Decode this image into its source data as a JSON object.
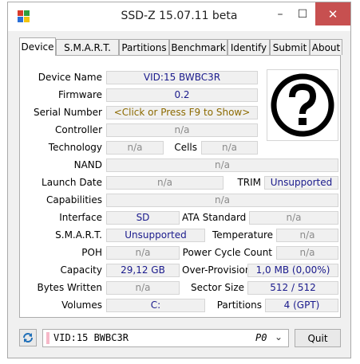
{
  "window": {
    "title": "SSD-Z 15.07.11 beta",
    "controls": {
      "minimize": "–",
      "maximize": "☐",
      "close": "✕"
    }
  },
  "tabs": [
    "Device",
    "S.M.A.R.T.",
    "Partitions",
    "Benchmark",
    "Identify",
    "Submit",
    "About"
  ],
  "active_tab": "Device",
  "device": {
    "device_name_label": "Device Name",
    "device_name": "VID:15 BWBC3R",
    "firmware_label": "Firmware",
    "firmware": "0.2",
    "serial_label": "Serial Number",
    "serial": "<Click or Press F9 to Show>",
    "controller_label": "Controller",
    "controller": "n/a",
    "technology_label": "Technology",
    "technology": "n/a",
    "cells_label": "Cells",
    "cells": "n/a",
    "nand_label": "NAND",
    "nand": "n/a",
    "launch_label": "Launch Date",
    "launch": "n/a",
    "trim_label": "TRIM",
    "trim": "Unsupported",
    "capabilities_label": "Capabilities",
    "capabilities": "n/a",
    "interface_label": "Interface",
    "interface": "SD",
    "ata_label": "ATA Standard",
    "ata": "n/a",
    "smart_label": "S.M.A.R.T.",
    "smart": "Unsupported",
    "temperature_label": "Temperature",
    "temperature": "n/a",
    "poh_label": "POH",
    "poh": "n/a",
    "pcc_label": "Power Cycle Count",
    "pcc": "n/a",
    "capacity_label": "Capacity",
    "capacity": "29,12 GB",
    "op_label": "Over-Provision",
    "op": "1,0 MB (0,00%)",
    "bytes_written_label": "Bytes Written",
    "bytes_written": "n/a",
    "sector_label": "Sector Size",
    "sector": "512 / 512",
    "volumes_label": "Volumes",
    "volumes": "C:",
    "partitions_label": "Partitions",
    "partitions": "4 (GPT)"
  },
  "bottom": {
    "selected_drive": "VID:15 BWBC3R",
    "drive_index": "P0",
    "quit_label": "Quit"
  },
  "colors": {
    "value_blue": "#1a1a8c",
    "serial_olive": "#8c6a00",
    "close_red": "#c75050"
  }
}
